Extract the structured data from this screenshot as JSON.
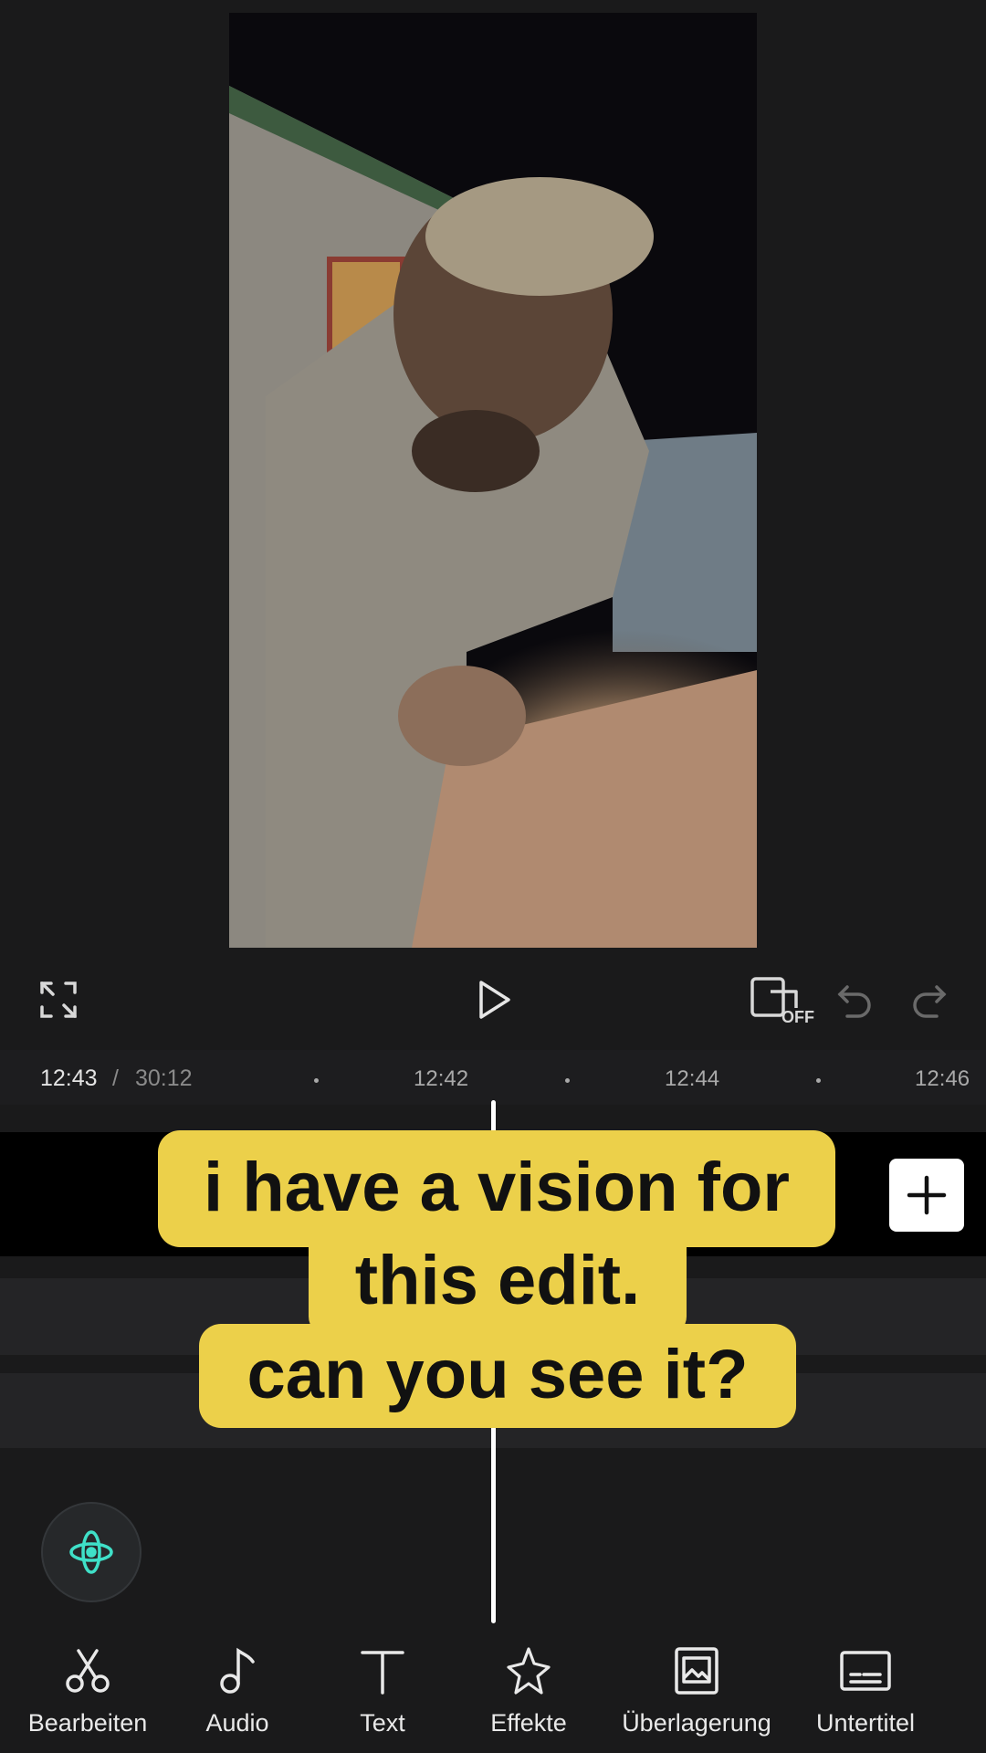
{
  "timeline": {
    "current_time": "12:43",
    "separator": "/",
    "total_time": "30:12",
    "ticks": [
      "12:42",
      "12:44",
      "12:46"
    ]
  },
  "caption": {
    "line1": "i have a vision for",
    "line2": "this edit.",
    "line3": "can you see it?"
  },
  "icons": {
    "fullscreen": "fullscreen-icon",
    "play": "play-icon",
    "pip": "pip-off-icon",
    "pip_badge": "OFF",
    "undo": "undo-icon",
    "redo": "redo-icon",
    "add": "plus-icon",
    "ai": "ai-assistant-icon"
  },
  "toolbar": {
    "items": [
      {
        "label": "Bearbeiten",
        "icon": "scissors-icon"
      },
      {
        "label": "Audio",
        "icon": "music-note-icon"
      },
      {
        "label": "Text",
        "icon": "text-icon"
      },
      {
        "label": "Effekte",
        "icon": "sparkle-star-icon"
      },
      {
        "label": "Überlagerung",
        "icon": "overlay-image-icon"
      },
      {
        "label": "Untertitel",
        "icon": "subtitles-icon"
      }
    ]
  },
  "colors": {
    "background": "#1a1a1b",
    "caption_bg": "#ecd04a",
    "accent": "#3fe0c8"
  }
}
